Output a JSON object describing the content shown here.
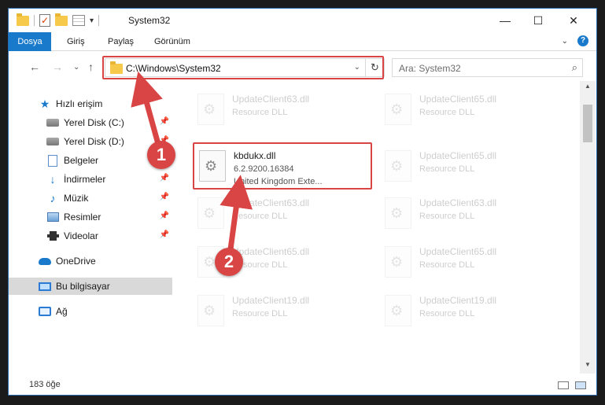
{
  "window": {
    "title": "System32",
    "controls": {
      "minimize": "—",
      "maximize": "☐",
      "close": "✕"
    }
  },
  "ribbon": {
    "tabs": [
      "Dosya",
      "Giriş",
      "Paylaş",
      "Görünüm"
    ],
    "help": "?"
  },
  "address": {
    "path": "C:\\Windows\\System32",
    "search_placeholder": "Ara: System32"
  },
  "nav_pane": {
    "items": [
      {
        "label": "Hızlı erişim",
        "icon": "star-icon"
      },
      {
        "label": "Yerel Disk (C:)",
        "icon": "disk-icon",
        "pinned": true
      },
      {
        "label": "Yerel Disk (D:)",
        "icon": "disk-icon",
        "pinned": true
      },
      {
        "label": "Belgeler",
        "icon": "document-icon",
        "pinned": true
      },
      {
        "label": "İndirmeler",
        "icon": "download-icon",
        "pinned": true
      },
      {
        "label": "Müzik",
        "icon": "music-icon",
        "pinned": true
      },
      {
        "label": "Resimler",
        "icon": "pictures-icon",
        "pinned": true
      },
      {
        "label": "Videolar",
        "icon": "videos-icon",
        "pinned": true
      },
      {
        "label": "OneDrive",
        "icon": "cloud-icon"
      },
      {
        "label": "Bu bilgisayar",
        "icon": "computer-icon",
        "selected": true
      },
      {
        "label": "Ağ",
        "icon": "network-icon"
      }
    ]
  },
  "files": [
    {
      "name": "UpdateClient63.dll",
      "desc": "Resource DLL"
    },
    {
      "name": "UpdateClient65.dll",
      "desc": "Resource DLL"
    },
    {
      "name": "kbdukx.dll",
      "desc": "6.2.9200.16384",
      "desc2": "United Kingdom Exte...",
      "highlight": true
    },
    {
      "name": "UpdateClient65.dll",
      "desc": "Resource DLL"
    },
    {
      "name": "UpdateClient63.dll",
      "desc": "Resource DLL"
    },
    {
      "name": "UpdateClient63.dll",
      "desc": "Resource DLL"
    },
    {
      "name": "UpdateClient65.dll",
      "desc": "Resource DLL"
    },
    {
      "name": "UpdateClient65.dll",
      "desc": "Resource DLL"
    },
    {
      "name": "UpdateClient19.dll",
      "desc": "Resource DLL"
    },
    {
      "name": "UpdateClient19.dll",
      "desc": "Resource DLL"
    }
  ],
  "status": {
    "count": "183 öğe"
  },
  "callouts": [
    "1",
    "2"
  ],
  "colors": {
    "accent": "#1979ca",
    "callout": "#d94545"
  }
}
